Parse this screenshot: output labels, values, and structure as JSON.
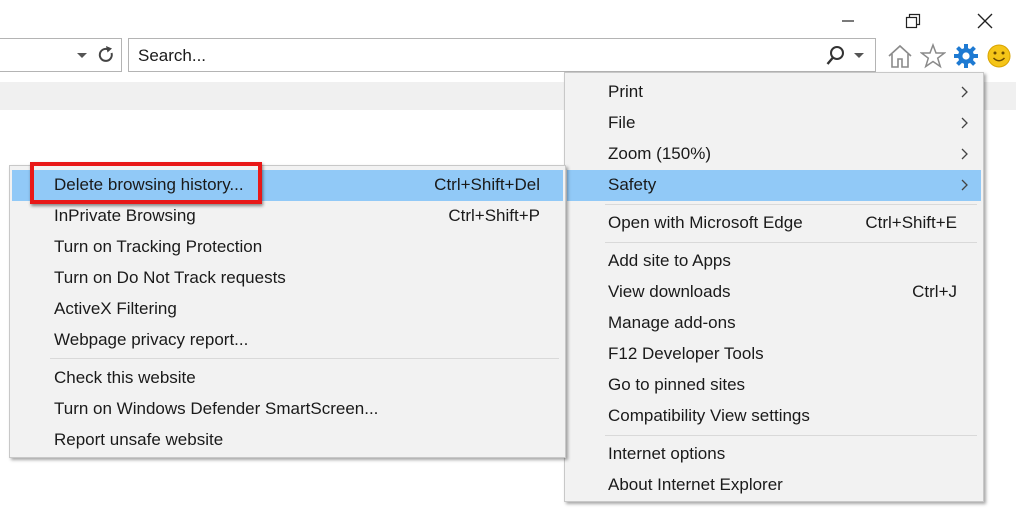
{
  "window": {
    "minimize_icon": "minimize-icon",
    "restore_icon": "restore-icon",
    "close_icon": "close-icon"
  },
  "address": {
    "dropdown_icon": "chevron-down-icon",
    "refresh_icon": "refresh-icon"
  },
  "search": {
    "placeholder": "Search...",
    "search_icon": "magnifier-icon",
    "dropdown_icon": "chevron-down-icon"
  },
  "toolbar": {
    "icons": [
      "home-icon",
      "star-icon",
      "gear-icon",
      "smiley-icon"
    ],
    "gear_color": "#1e7ad2",
    "smiley_color": "#f5c518"
  },
  "tools_menu": {
    "items": [
      {
        "label": "Print",
        "shortcut": "",
        "submenu": true
      },
      {
        "label": "File",
        "shortcut": "",
        "submenu": true
      },
      {
        "label": "Zoom (150%)",
        "shortcut": "",
        "submenu": true
      },
      {
        "label": "Safety",
        "shortcut": "",
        "submenu": true,
        "highlighted": true
      },
      {
        "label": "Open with Microsoft Edge",
        "shortcut": "Ctrl+Shift+E"
      },
      {
        "label": "Add site to Apps",
        "shortcut": ""
      },
      {
        "label": "View downloads",
        "shortcut": "Ctrl+J"
      },
      {
        "label": "Manage add-ons",
        "shortcut": ""
      },
      {
        "label": "F12 Developer Tools",
        "shortcut": ""
      },
      {
        "label": "Go to pinned sites",
        "shortcut": ""
      },
      {
        "label": "Compatibility View settings",
        "shortcut": ""
      },
      {
        "label": "Internet options",
        "shortcut": ""
      },
      {
        "label": "About Internet Explorer",
        "shortcut": ""
      }
    ]
  },
  "safety_menu": {
    "items": [
      {
        "label": "Delete browsing history...",
        "shortcut": "Ctrl+Shift+Del",
        "highlighted": true
      },
      {
        "label": "InPrivate Browsing",
        "shortcut": "Ctrl+Shift+P"
      },
      {
        "label": "Turn on Tracking Protection",
        "shortcut": ""
      },
      {
        "label": "Turn on Do Not Track requests",
        "shortcut": ""
      },
      {
        "label": "ActiveX Filtering",
        "shortcut": ""
      },
      {
        "label": "Webpage privacy report...",
        "shortcut": ""
      },
      {
        "label": "Check this website",
        "shortcut": ""
      },
      {
        "label": "Turn on Windows Defender SmartScreen...",
        "shortcut": ""
      },
      {
        "label": "Report unsafe website",
        "shortcut": ""
      }
    ]
  },
  "colors": {
    "highlight": "#91c9f7",
    "annotation_box": "#e81818",
    "menu_bg": "#f2f2f2"
  }
}
